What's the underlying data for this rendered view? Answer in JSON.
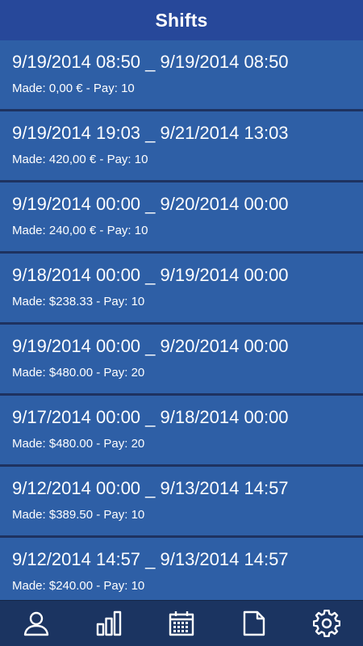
{
  "header": {
    "title": "Shifts"
  },
  "shifts": [
    {
      "range": "9/19/2014 08:50 _ 9/19/2014 08:50",
      "detail": "Made: 0,00 € - Pay: 10"
    },
    {
      "range": "9/19/2014 19:03 _ 9/21/2014 13:03",
      "detail": "Made: 420,00 € - Pay: 10"
    },
    {
      "range": "9/19/2014 00:00 _ 9/20/2014 00:00",
      "detail": "Made: 240,00 € - Pay: 10"
    },
    {
      "range": "9/18/2014 00:00 _ 9/19/2014 00:00",
      "detail": "Made: $238.33 - Pay: 10"
    },
    {
      "range": "9/19/2014 00:00 _ 9/20/2014 00:00",
      "detail": "Made: $480.00 - Pay: 20"
    },
    {
      "range": "9/17/2014 00:00 _ 9/18/2014 00:00",
      "detail": "Made: $480.00 - Pay: 20"
    },
    {
      "range": "9/12/2014 00:00 _ 9/13/2014 14:57",
      "detail": "Made: $389.50 - Pay: 10"
    },
    {
      "range": "9/12/2014 14:57 _ 9/13/2014 14:57",
      "detail": "Made: $240.00 - Pay: 10"
    }
  ],
  "nav": {
    "items": [
      {
        "icon": "person-icon"
      },
      {
        "icon": "bar-chart-icon"
      },
      {
        "icon": "calendar-icon"
      },
      {
        "icon": "document-icon"
      },
      {
        "icon": "gear-icon"
      }
    ]
  },
  "colors": {
    "header_bg": "#27489a",
    "item_bg": "#2e5fa6",
    "separator": "#1e3260",
    "nav_bg": "#1b3461",
    "text": "#ffffff"
  }
}
